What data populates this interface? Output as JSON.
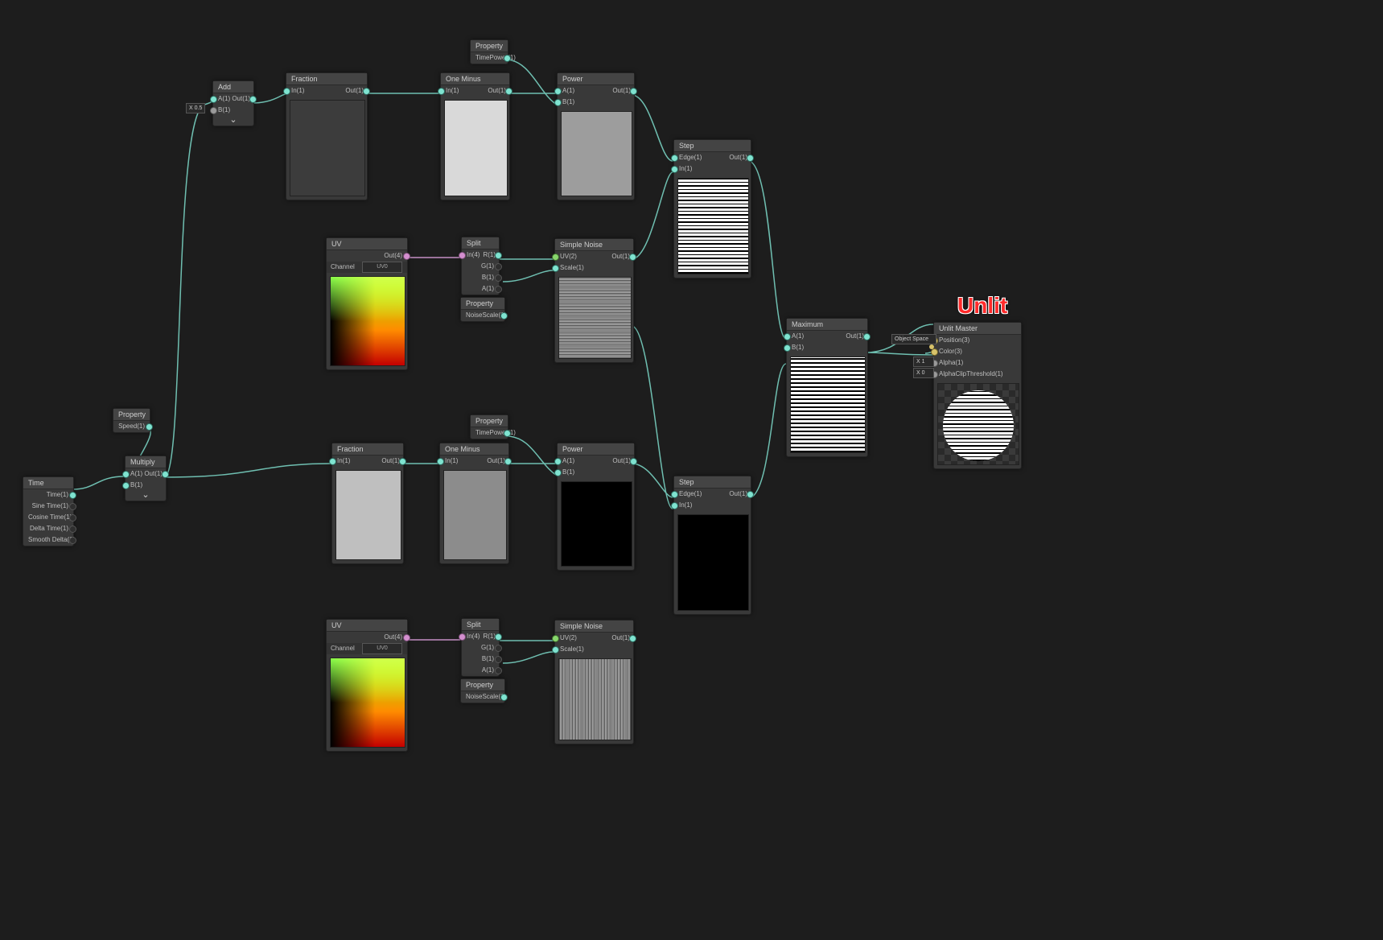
{
  "canvas": {
    "bg": "#1d1d1d"
  },
  "labels": {
    "unlit": "Unlit"
  },
  "nodes": {
    "time": {
      "title": "Time",
      "out": [
        "Time(1)",
        "Sine Time(1)",
        "Cosine Time(1)",
        "Delta Time(1)",
        "Smooth Delta(1)"
      ]
    },
    "propSpeed": {
      "title": "Property",
      "out": "Speed(1)"
    },
    "multiply": {
      "title": "Multiply",
      "inA": "A(1)",
      "inB": "B(1)",
      "out": "Out(1)"
    },
    "add": {
      "title": "Add",
      "inA": "A(1)",
      "inB": "B(1)",
      "out": "Out(1)",
      "inlineX": "X 0.5"
    },
    "fraction1": {
      "title": "Fraction",
      "in": "In(1)",
      "out": "Out(1)"
    },
    "oneMinus1": {
      "title": "One Minus",
      "in": "In(1)",
      "out": "Out(1)"
    },
    "propTP1": {
      "title": "Property",
      "out": "TimePower(1)"
    },
    "power1": {
      "title": "Power",
      "inA": "A(1)",
      "inB": "B(1)",
      "out": "Out(1)"
    },
    "uv1": {
      "title": "UV",
      "out": "Out(4)",
      "channel": "Channel",
      "dd": "UV0"
    },
    "split1": {
      "title": "Split",
      "in": "In(4)",
      "out": [
        "R(1)",
        "G(1)",
        "B(1)",
        "A(1)"
      ]
    },
    "propNS1": {
      "title": "Property",
      "out": "NoiseScale(1)"
    },
    "noise1": {
      "title": "Simple Noise",
      "inUV": "UV(2)",
      "inScale": "Scale(1)",
      "out": "Out(1)"
    },
    "step1": {
      "title": "Step",
      "inEdge": "Edge(1)",
      "inIn": "In(1)",
      "out": "Out(1)"
    },
    "fraction2": {
      "title": "Fraction",
      "in": "In(1)",
      "out": "Out(1)"
    },
    "oneMinus2": {
      "title": "One Minus",
      "in": "In(1)",
      "out": "Out(1)"
    },
    "propTP2": {
      "title": "Property",
      "out": "TimePower(1)"
    },
    "power2": {
      "title": "Power",
      "inA": "A(1)",
      "inB": "B(1)",
      "out": "Out(1)"
    },
    "uv2": {
      "title": "UV",
      "out": "Out(4)",
      "channel": "Channel",
      "dd": "UV0"
    },
    "split2": {
      "title": "Split",
      "in": "In(4)",
      "out": [
        "R(1)",
        "G(1)",
        "B(1)",
        "A(1)"
      ]
    },
    "propNS2": {
      "title": "Property",
      "out": "NoiseScale(1)"
    },
    "noise2": {
      "title": "Simple Noise",
      "inUV": "UV(2)",
      "inScale": "Scale(1)",
      "out": "Out(1)"
    },
    "step2": {
      "title": "Step",
      "inEdge": "Edge(1)",
      "inIn": "In(1)",
      "out": "Out(1)"
    },
    "maximum": {
      "title": "Maximum",
      "inA": "A(1)",
      "inB": "B(1)",
      "out": "Out(1)"
    },
    "master": {
      "title": "Unlit Master",
      "in": [
        "Position(3)",
        "Color(3)",
        "Alpha(1)",
        "AlphaClipThreshold(1)"
      ],
      "objectSpace": "Object Space",
      "x1": "X 1",
      "x0": "X 0"
    }
  }
}
